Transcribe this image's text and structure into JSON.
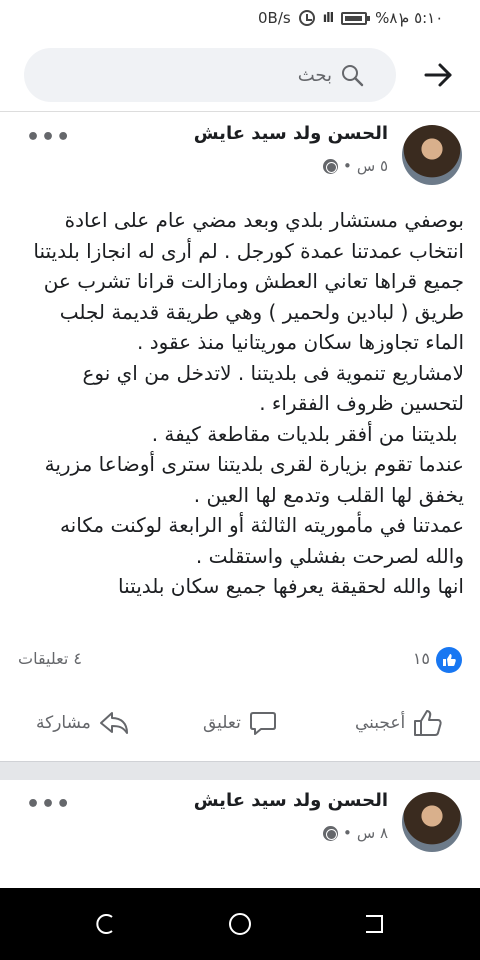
{
  "status_bar": {
    "time": "٥:١٠ م",
    "battery": "%٨١",
    "network_speed": "0B/s"
  },
  "search": {
    "placeholder": "بحث"
  },
  "posts": [
    {
      "author": "الحسن ولد سيد عايش",
      "time": "٥ س",
      "dot": "•",
      "text": "بوصفي مستشار بلدي وبعد مضي عام على اعادة انتخاب عمدتنا عمدة كورجل . لم أرى له انجازا بلديتنا جميع قراها تعاني العطش ومازالت قرانا تشرب عن طريق ( لبادين ولحمير ) وهي طريقة قديمة لجلب الماء تجاوزها سكان موريتانيا منذ عقود .\nلامشاريع تنموية فى بلديتنا . لاتدخل من اي نوع لتحسين ظروف الفقراء .\n بلديتنا من أفقر بلديات مقاطعة كيفة .\nعندما تقوم بزيارة لقرى بلديتنا سترى أوضاعا مزرية يخفق لها القلب وتدمع لها العين .\nعمدتنا في مأموريته الثالثة أو الرابعة لوكنت مكانه والله لصرحت بفشلي واستقلت .\nانها والله لحقيقة يعرفها جميع سكان بلديتنا",
      "likes": "١٥",
      "comments": "٤ تعليقات"
    },
    {
      "author": "الحسن ولد سيد عايش",
      "time": "٨ س",
      "dot": "•"
    }
  ],
  "actions": {
    "like": "أعجبني",
    "comment": "تعليق",
    "share": "مشاركة"
  },
  "icons": {
    "search": "search-icon",
    "back": "back-arrow-icon",
    "more": "more-dots-icon",
    "globe": "globe-icon",
    "like": "thumbs-up-icon",
    "comment": "comment-bubble-icon",
    "share": "share-arrow-icon"
  },
  "colors": {
    "facebook_blue": "#1877f2",
    "muted_text": "#65676b"
  }
}
